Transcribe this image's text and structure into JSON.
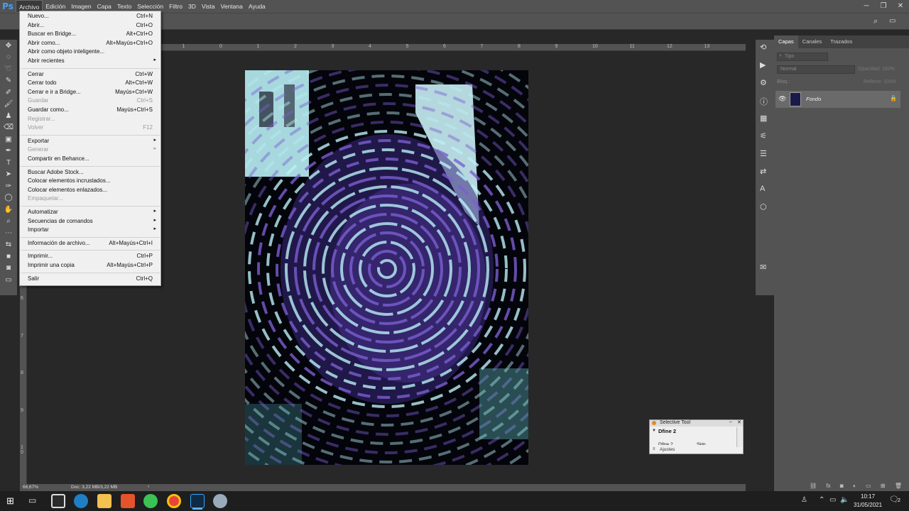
{
  "app": {
    "logo": "Ps"
  },
  "menubar": {
    "items": [
      "Archivo",
      "Edición",
      "Imagen",
      "Capa",
      "Texto",
      "Selección",
      "Filtro",
      "3D",
      "Vista",
      "Ventana",
      "Ayuda"
    ]
  },
  "file_menu": {
    "groups": [
      [
        {
          "label": "Nuevo...",
          "shortcut": "Ctrl+N"
        },
        {
          "label": "Abrir...",
          "shortcut": "Ctrl+O"
        },
        {
          "label": "Buscar en Bridge...",
          "shortcut": "Alt+Ctrl+O"
        },
        {
          "label": "Abrir como...",
          "shortcut": "Alt+Mayús+Ctrl+O"
        },
        {
          "label": "Abrir como objeto inteligente...",
          "shortcut": ""
        },
        {
          "label": "Abrir recientes",
          "shortcut": "",
          "submenu": true
        }
      ],
      [
        {
          "label": "Cerrar",
          "shortcut": "Ctrl+W"
        },
        {
          "label": "Cerrar todo",
          "shortcut": "Alt+Ctrl+W"
        },
        {
          "label": "Cerrar e ir a Bridge...",
          "shortcut": "Mayús+Ctrl+W"
        },
        {
          "label": "Guardar",
          "shortcut": "Ctrl+S",
          "disabled": true
        },
        {
          "label": "Guardar como...",
          "shortcut": "Mayús+Ctrl+S"
        },
        {
          "label": "Registrar...",
          "shortcut": "",
          "disabled": true
        },
        {
          "label": "Volver",
          "shortcut": "F12",
          "disabled": true
        }
      ],
      [
        {
          "label": "Exportar",
          "shortcut": "",
          "submenu": true
        },
        {
          "label": "Generar",
          "shortcut": "",
          "submenu": true,
          "disabled": true
        },
        {
          "label": "Compartir en Behance...",
          "shortcut": ""
        }
      ],
      [
        {
          "label": "Buscar Adobe Stock...",
          "shortcut": ""
        },
        {
          "label": "Colocar elementos incrustados...",
          "shortcut": ""
        },
        {
          "label": "Colocar elementos enlazados...",
          "shortcut": ""
        },
        {
          "label": "Empaquetar...",
          "shortcut": "",
          "disabled": true
        }
      ],
      [
        {
          "label": "Automatizar",
          "shortcut": "",
          "submenu": true
        },
        {
          "label": "Secuencias de comandos",
          "shortcut": "",
          "submenu": true
        },
        {
          "label": "Importar",
          "shortcut": "",
          "submenu": true
        }
      ],
      [
        {
          "label": "Información de archivo...",
          "shortcut": "Alt+Mayús+Ctrl+I"
        }
      ],
      [
        {
          "label": "Imprimir...",
          "shortcut": "Ctrl+P"
        },
        {
          "label": "Imprimir una copia",
          "shortcut": "Alt+Mayús+Ctrl+P"
        }
      ],
      [
        {
          "label": "Salir",
          "shortcut": "Ctrl+Q"
        }
      ]
    ]
  },
  "ruler": {
    "top_ticks": [
      "2",
      "1",
      "0",
      "1",
      "2",
      "3",
      "4",
      "5",
      "6",
      "7",
      "8",
      "9",
      "10",
      "11",
      "12",
      "13"
    ],
    "left_ticks": [
      "6",
      "7",
      "8",
      "9",
      "1\n0"
    ]
  },
  "layers_panel": {
    "tabs": [
      "Capas",
      "Canales",
      "Trazados"
    ],
    "search_placeholder": "Tipo",
    "blend_mode": "Normal",
    "opacity_label": "Opacidad:",
    "opacity_value": "100%",
    "lock_label": "Bloq.:",
    "fill_label": "Relleno:",
    "fill_value": "100%",
    "layers": [
      {
        "name": "Fondo",
        "locked": true,
        "visible": true
      }
    ]
  },
  "status": {
    "zoom": "66,67%",
    "doc": "Doc: 3,22 MB/3,22 MB"
  },
  "selective_tool": {
    "title": "Selective Tool",
    "section": "Dfine 2",
    "item1": "Dfine 2",
    "item2": "Skin",
    "footer": "Ajustes"
  },
  "taskbar": {
    "time": "10:17",
    "date": "31/05/2021",
    "notification_count": "2"
  },
  "colors": {
    "accent": "#4a9ff5",
    "canvas_cyan": "#b9f0f5",
    "canvas_purple": "#6a4fc0"
  }
}
